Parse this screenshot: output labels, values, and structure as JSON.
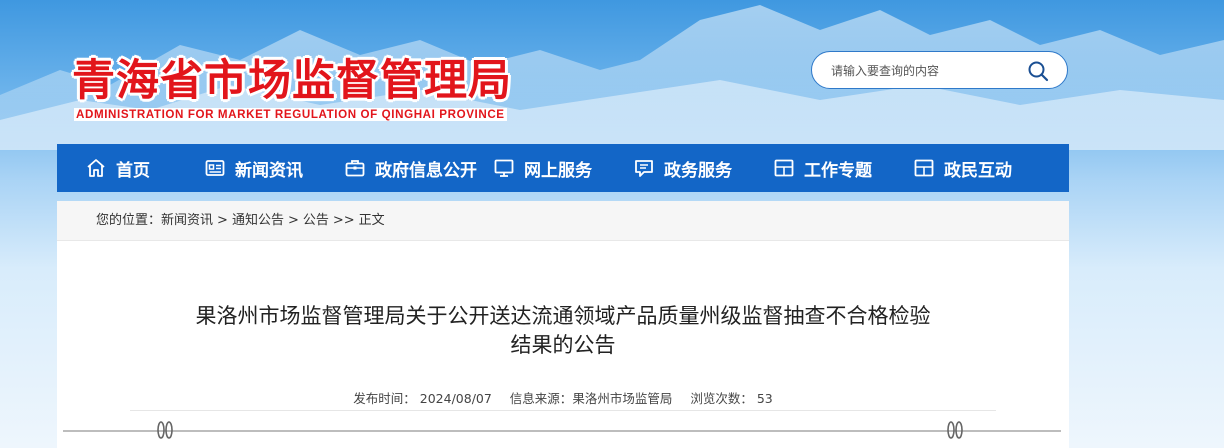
{
  "header": {
    "logo_cn": "青海省市场监督管理局",
    "logo_en": "ADMINISTRATION FOR MARKET REGULATION OF QINGHAI PROVINCE",
    "search_placeholder": "请输入要查询的内容",
    "search_icon": "search-icon"
  },
  "nav": {
    "items": [
      {
        "label": "首页",
        "icon": "home-icon"
      },
      {
        "label": "新闻资讯",
        "icon": "news-icon"
      },
      {
        "label": "政府信息公开",
        "icon": "briefcase-icon"
      },
      {
        "label": "网上服务",
        "icon": "monitor-icon"
      },
      {
        "label": "政务服务",
        "icon": "chat-icon"
      },
      {
        "label": "工作专题",
        "icon": "layout-icon"
      },
      {
        "label": "政民互动",
        "icon": "layout-icon"
      }
    ],
    "color": "#1366c7"
  },
  "breadcrumb": {
    "prefix": "您的位置：",
    "items": [
      "新闻资讯",
      "通知公告",
      "公告",
      "正文"
    ],
    "sep1": ">",
    "sep2": ">",
    "sep3": ">>"
  },
  "article": {
    "title_line1": "果洛州市场监督管理局关于公开送达流通领域产品质量州级监督抽查不合格检验",
    "title_line2": "结果的公告",
    "publish_label": "发布时间：",
    "publish_date": "2024/08/07",
    "source_label": "信息来源：",
    "source": "果洛州市场监管局",
    "views_label": "浏览次数：",
    "views": "53"
  },
  "colors": {
    "brand_red": "#e2151b",
    "nav_blue": "#1366c7"
  }
}
